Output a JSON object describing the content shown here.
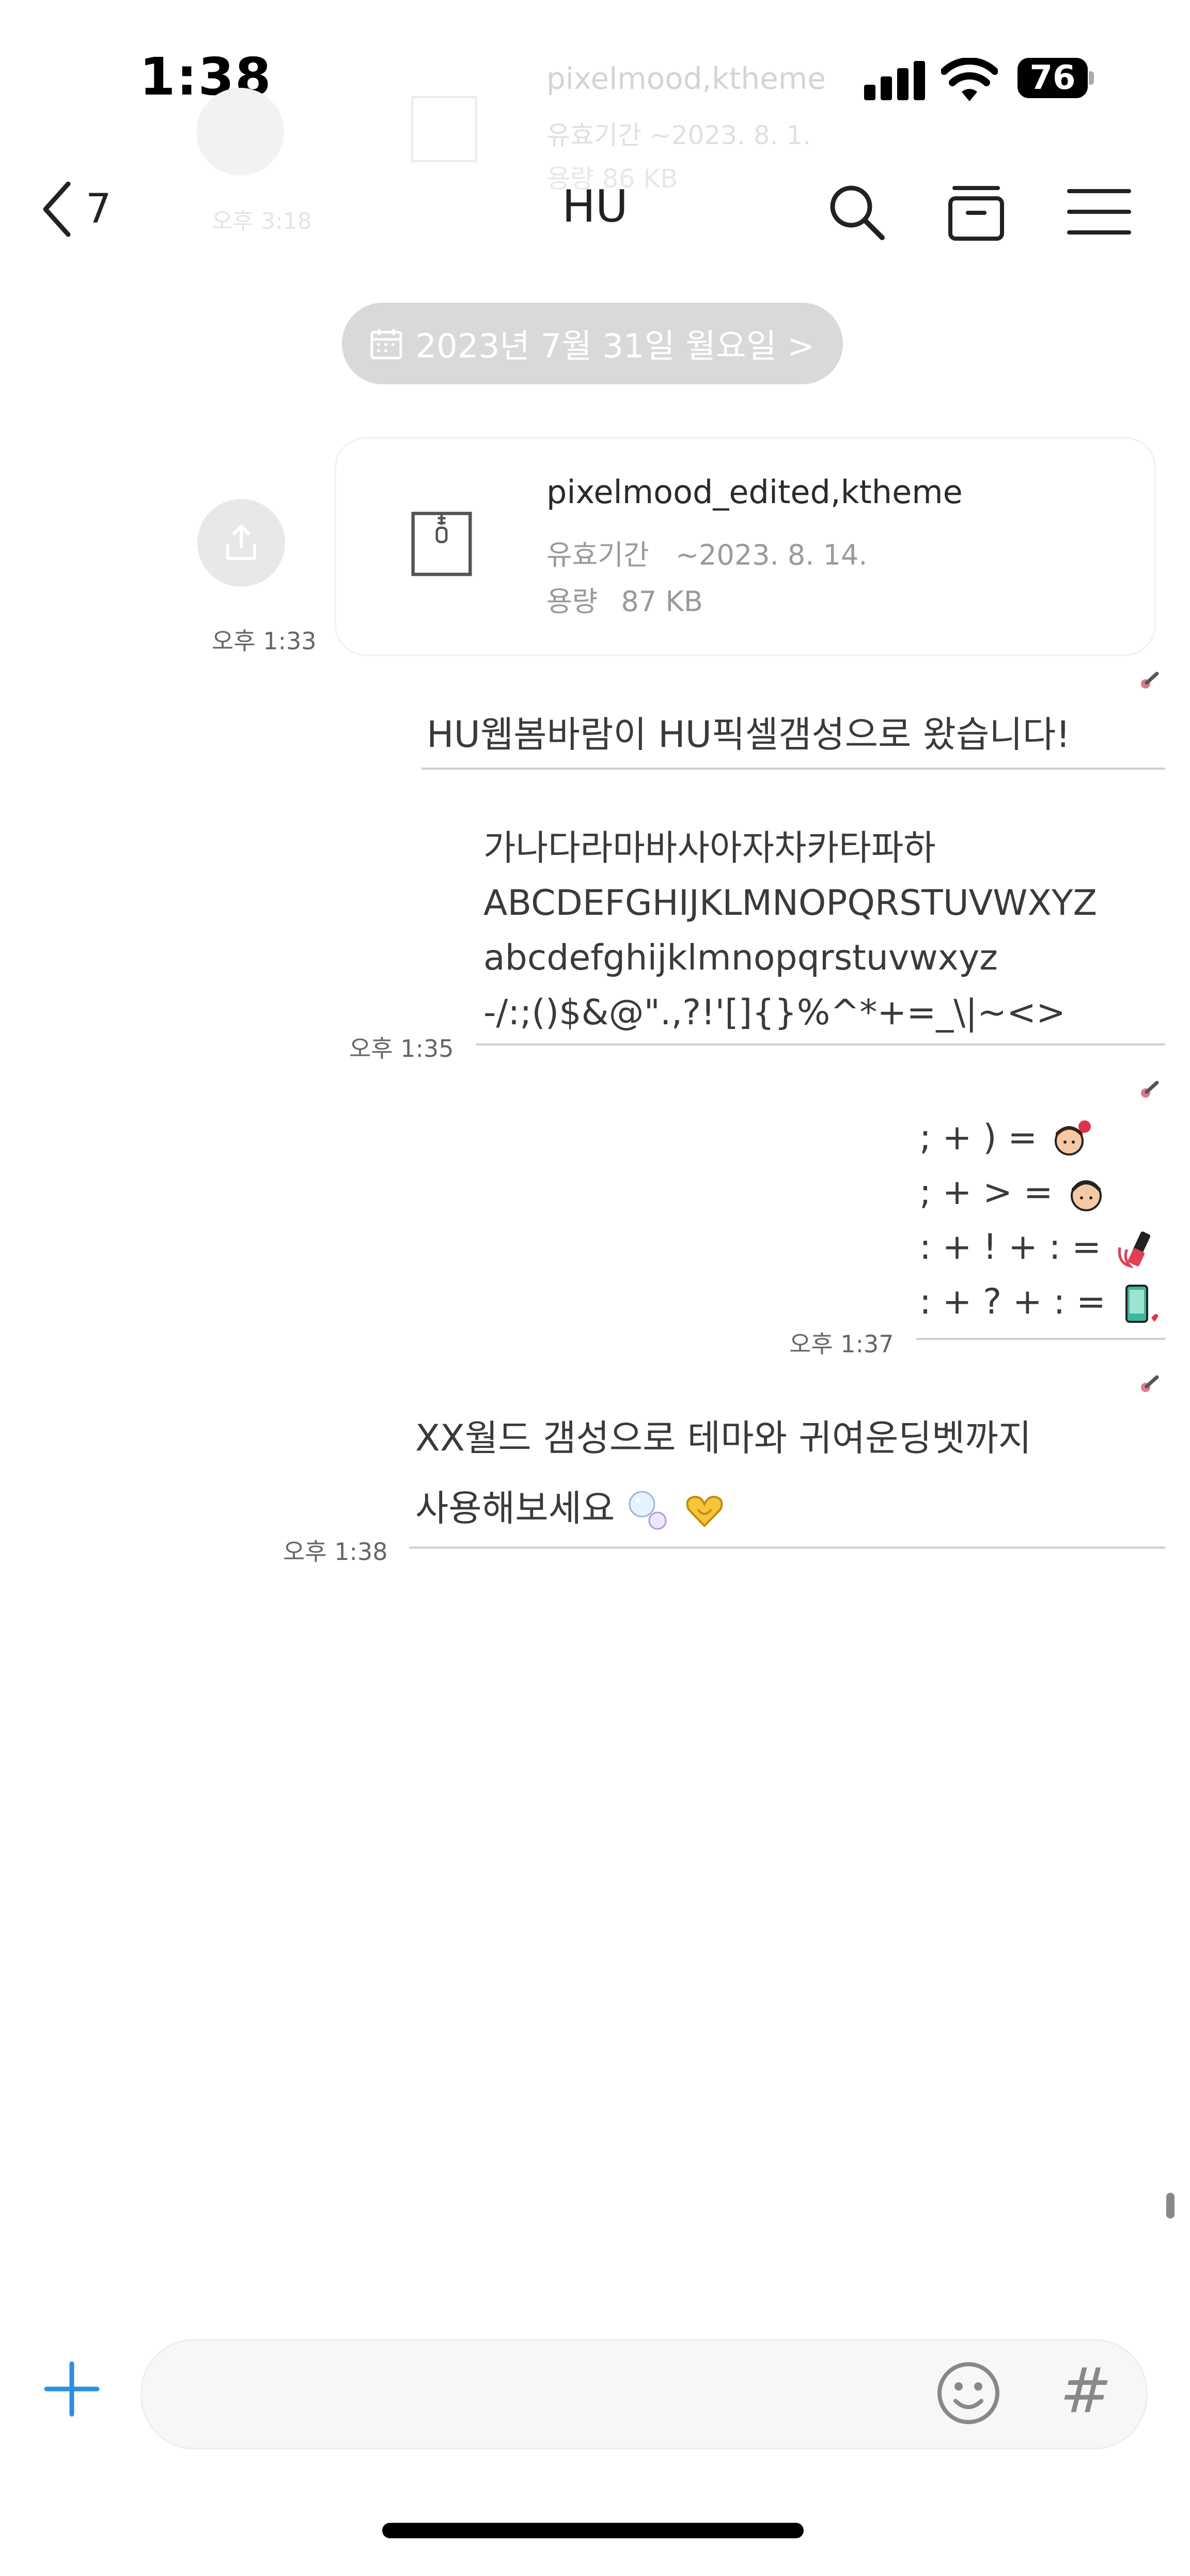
{
  "status_bar": {
    "time": "1:38",
    "battery": "76"
  },
  "ghost": {
    "file_name": "pixelmood,ktheme",
    "expiry": "유효기간  ~2023. 8. 1.",
    "size": "용량  86 KB",
    "time": "오후 3:18"
  },
  "header": {
    "back_count": "7",
    "title": "HU"
  },
  "date_pill": {
    "label": "2023년 7월 31일 월요일 >"
  },
  "file_message": {
    "name": "pixelmood_edited,ktheme",
    "expiry_label": "유효기간",
    "expiry_value": "~2023. 8. 14.",
    "size_label": "용량",
    "size_value": "87 KB",
    "time": "오후 1:33"
  },
  "messages": {
    "m1": {
      "text": "HU웹봄바람이 HU픽셀갬성으로 왔습니다!"
    },
    "m2": {
      "lines": [
        "가나다라마바사아자차카타파하",
        "ABCDEFGHIJKLMNOPQRSTUVWXYZ",
        "abcdefghijklmnopqrstuvwxyz",
        "-/:;()$&@\".,?!'[]{}%^*+=_\\|~<>"
      ],
      "time": "오후 1:35"
    },
    "m3": {
      "lines": [
        "; + ) =",
        "; + > =",
        ": + ! + : =",
        ": + ? + : ="
      ],
      "time": "오후 1:37"
    },
    "m4": {
      "line1": "XX월드 갬성으로 테마와 귀여운딩벳까지",
      "line2": "사용해보세요",
      "time": "오후 1:38"
    }
  },
  "colors": {
    "accent": "#2d8fe0",
    "pill": "#d9d9d9",
    "divider": "#cfcfcf"
  },
  "icons": [
    "back-chevron-icon",
    "search-icon",
    "drawer-icon",
    "menu-icon",
    "calendar-icon",
    "share-icon",
    "zip-file-icon",
    "plus-icon",
    "emoji-icon",
    "hash-icon"
  ]
}
